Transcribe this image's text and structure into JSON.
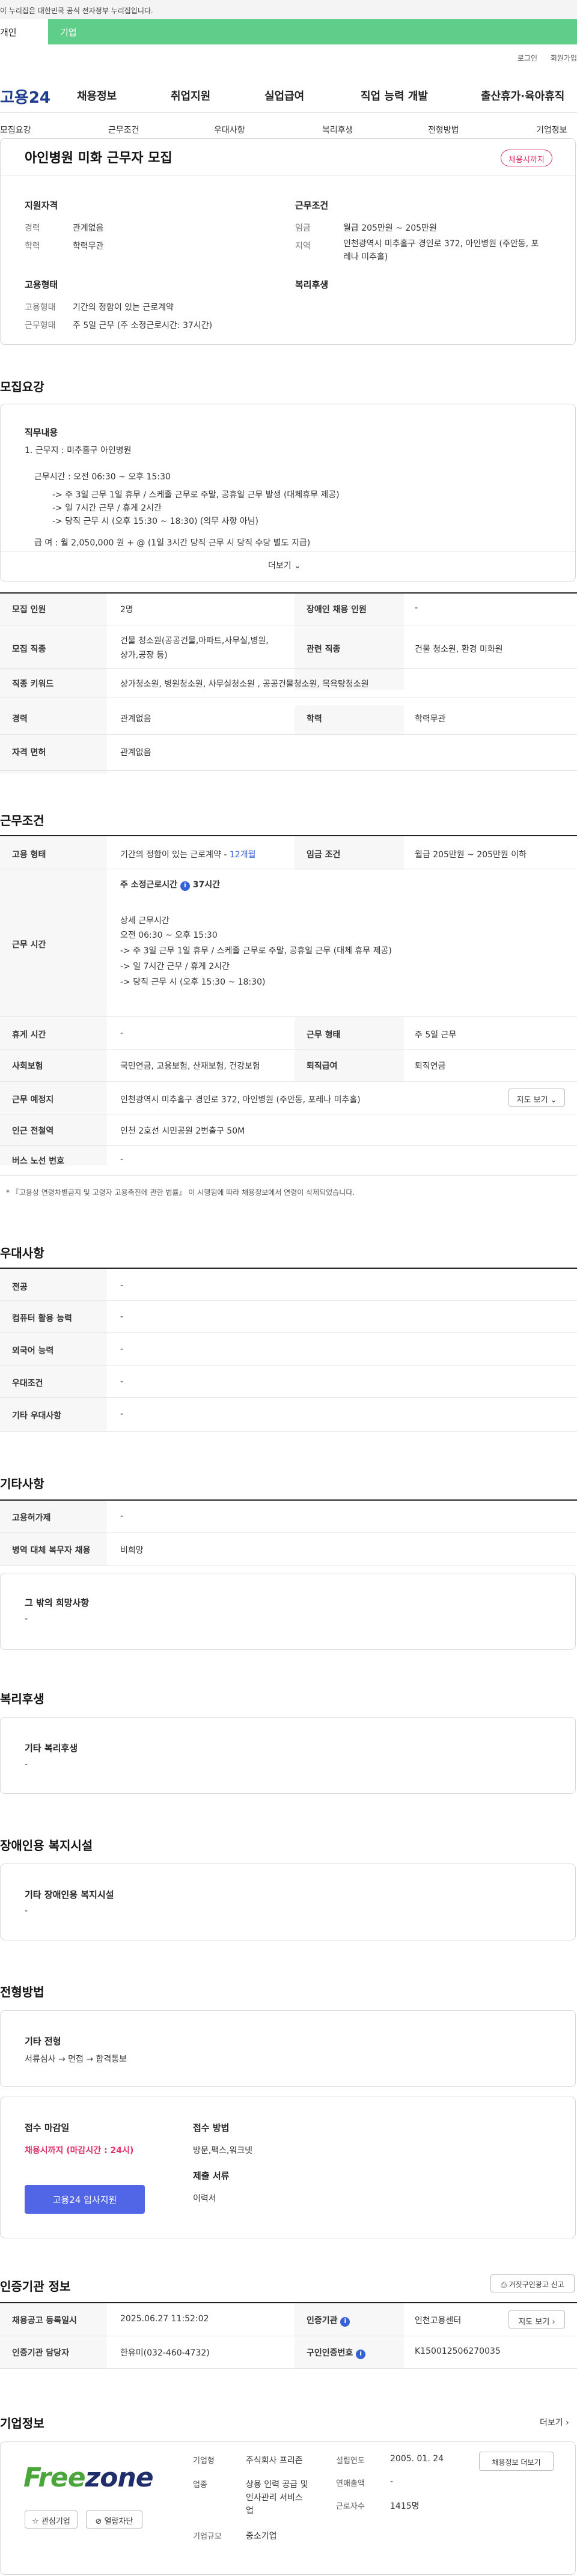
{
  "gov_banner": {
    "text": "이 누리집은 대한민국 공식 전자정부 누리집입니다."
  },
  "top_tabs": [
    "개인",
    "기업"
  ],
  "util_links": [
    "로그인",
    "회원가입"
  ],
  "gnb": {
    "logo": "고용24",
    "menu": [
      "채용정보",
      "취업지원",
      "실업급여",
      "직업 능력 개발",
      "출산휴가·육아휴직"
    ]
  },
  "lnb": [
    "모집요강",
    "근무조건",
    "우대사항",
    "복리후생",
    "전형방법",
    "기업정보"
  ],
  "summary": {
    "title": "아인병원 미화 근무자 모집",
    "status": "채용시까지",
    "left": {
      "h1": "지원자격",
      "career_l": "경력",
      "career_v": "관계없음",
      "edu_l": "학력",
      "edu_v": "학력무관",
      "h2": "고용형태",
      "type_l": "고용형태",
      "type_v": "기간의 정함이 있는 근로계약",
      "work_l": "근무형태",
      "work_v": "주 5일 근무 (주 소정근로시간: 37시간)"
    },
    "right": {
      "h1": "근무조건",
      "wage_l": "임금",
      "wage_v": "월급 205만원 ~ 205만원",
      "loc_l": "지역",
      "loc_v1": "인천광역시 미추홀구 경인로 372, 아인병원 (주안동, 포",
      "loc_v2": "레나 미추홀)",
      "h2": "복리후생"
    }
  },
  "recruit": {
    "title": "모집요강",
    "duty_h": "직무내용",
    "lines": [
      "1. 근무지 : 미추홀구 아인병원",
      "근무시간 : 오전 06:30 ~ 오후 15:30",
      "-> 주 3일 근무 1일 휴무 / 스케줄 근무로 주말, 공휴일 근무 발생 (대체휴무 제공)",
      "-> 일 7시간 근무 / 휴게 2시간",
      "-> 당직 근무 시 (오후 15:30 ~ 18:30) (의무 사항 아님)",
      "급 여 : 월 2,050,000 원 + @ (1일 3시간 당직 근무 시 당직 수당 별도 지급)"
    ],
    "more": "더보기",
    "rows": [
      {
        "l": "모집 인원",
        "v": "2명",
        "l2": "장애인 채용 인원",
        "v2": "-"
      },
      {
        "l": "모집 직종",
        "v1": "건물 청소원(공공건물,아파트,사무실,병원,",
        "v2line": "상가,공장 등)",
        "l2": "관련 직종",
        "v2": "건물 청소원, 환경 미화원"
      },
      {
        "l": "직종 키워드",
        "v": "상가청소원, 병원청소원, 사무실청소원 , 공공건물청소원, 목욕탕청소원"
      },
      {
        "l": "경력",
        "v": "관계없음",
        "l2": "학력",
        "v2": "학력무관"
      },
      {
        "l": "자격 면허",
        "v": "관계없음"
      }
    ]
  },
  "conditions": {
    "title": "근무조건",
    "type_l": "고용 형태",
    "type_v": "기간의 정함이 있는 근로계약 - ",
    "type_v_link": "12개월",
    "wage_l": "임금 조건",
    "wage_v": "월급 205만원 ~ 205만원 이하",
    "time_l": "근무 시간",
    "time_h1": "주 소정근로시간",
    "time_h1_v": "37시간",
    "time_h2": "상세 근무시간",
    "time_lines": [
      "오전 06:30 ~ 오후 15:30",
      "-> 주 3일 근무 1일 휴무 / 스케줄 근무로 주말, 공휴일 근무 (대체 휴무 제공)",
      "-> 일 7시간 근무 / 휴게 2시간",
      "-> 당직 근무 시 (오후 15:30 ~ 18:30)"
    ],
    "rest_l": "휴게 시간",
    "rest_v": "-",
    "form_l": "근무 형태",
    "form_v": "주 5일 근무",
    "ins_l": "사회보험",
    "ins_v": "국민연금, 고용보험, 산재보험, 건강보험",
    "ret_l": "퇴직급여",
    "ret_v": "퇴직연금",
    "place_l": "근무 예정지",
    "place_v": "인천광역시 미추홀구 경인로 372, 아인병원 (주안동, 포레나 미추홀)",
    "map_btn": "지도 보기",
    "sub_l": "인근 전철역",
    "sub_v": "인천 2호선 시민공원 2번출구 50M",
    "bus_l": "버스 노선 번호",
    "bus_v": "-",
    "note": "* 『고용상 연령차별금지 및 고령자 고용촉진에 관한 법률』 이 시행됨에 따라 채용정보에서 연령이 삭제되었습니다."
  },
  "preferred": {
    "title": "우대사항",
    "rows": [
      {
        "l": "전공",
        "v": "-"
      },
      {
        "l": "컴퓨터 활용 능력",
        "v": "-"
      },
      {
        "l": "외국어 능력",
        "v": "-"
      },
      {
        "l": "우대조건",
        "v": "-"
      },
      {
        "l": "기타 우대사항",
        "v": "-"
      }
    ]
  },
  "etc": {
    "title": "기타사항",
    "rows": [
      {
        "l": "고용허가제",
        "v": "-"
      },
      {
        "l": "병역 대체 복무자 채용",
        "v": "비희망"
      }
    ],
    "box_h": "그 밖의 희망사항",
    "box_v": "-"
  },
  "welfare": {
    "title": "복리후생",
    "box_h": "기타 복리후생",
    "box_v": "-"
  },
  "disabled": {
    "title": "장애인용 복지시설",
    "box_h": "기타 장애인용 복지시설",
    "box_v": "-"
  },
  "selection": {
    "title": "전형방법",
    "box_h": "기타 전형",
    "box_v": "서류심사 → 면접 → 합격통보",
    "deadline_h": "접수 마감일",
    "deadline_v": "채용시까지 (마감시간 : 24시)",
    "method_h": "접수 방법",
    "method_v": "방문,팩스,워크넷",
    "docs_h": "제출 서류",
    "docs_v": "이력서",
    "apply_btn": "고용24 입사지원"
  },
  "agency": {
    "title": "인증기관 정보",
    "print_btn": "거짓구인광고 신고",
    "reg_l": "채용공고 등록일시",
    "reg_v": "2025.06.27 11:52:02",
    "org_l": "인증기관",
    "org_v": "인천고용센터",
    "map_btn": "지도 보기",
    "mgr_l": "인증기관 담당자",
    "mgr_v": "한유미(032-460-4732)",
    "num_l": "구인인증번호",
    "num_v": "K150012506270035"
  },
  "company": {
    "title": "기업정보",
    "more": "더보기",
    "logo_a": "Free",
    "logo_b": "zone",
    "fav_btn": "관심기업",
    "block_btn": "열람차단",
    "type_l": "기업형",
    "type_v": "주식회사 프리존",
    "ind_l": "업종",
    "ind_v1": "상용 인력 공급 및",
    "ind_v2": "인사관리 서비스",
    "ind_v3": "업",
    "size_l": "기업규모",
    "size_v": "중소기업",
    "est_l": "설립연도",
    "est_v": "2005. 01. 24",
    "sales_l": "연매출액",
    "sales_v": "-",
    "emp_l": "근로자수",
    "emp_v": "1415명",
    "detail_btn": "채용정보 더보기"
  },
  "colors": {
    "green": "#5fce8a",
    "navy": "#1e3d8f",
    "pink": "#e0306a",
    "blue": "#3761d8",
    "button": "#5166e6"
  }
}
